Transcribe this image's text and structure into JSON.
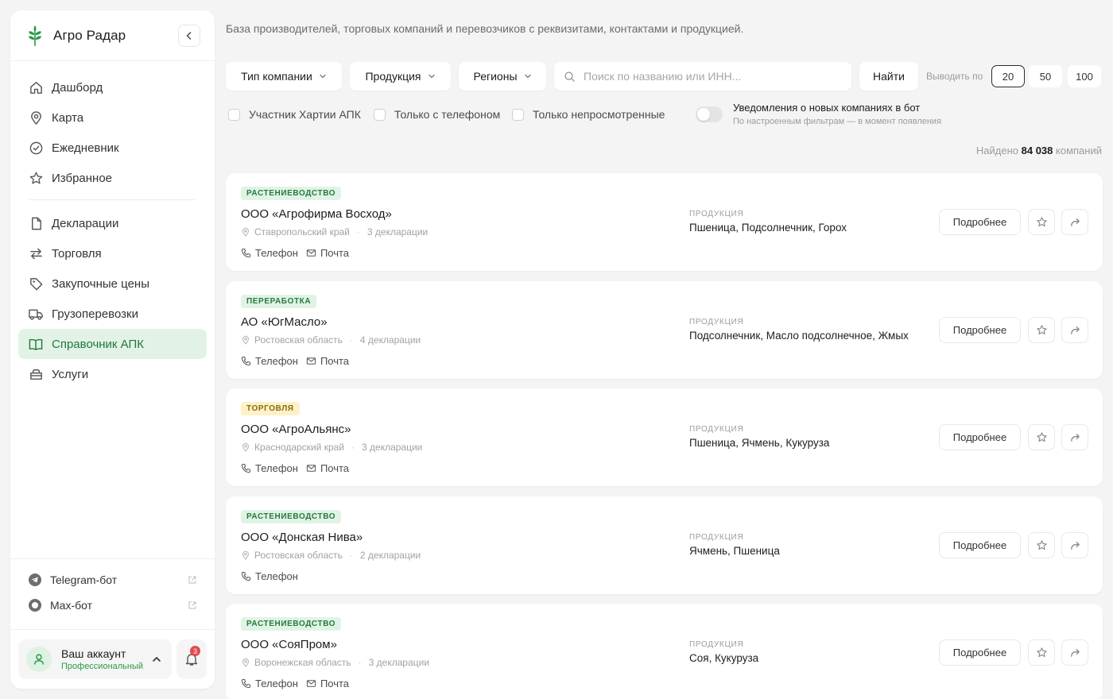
{
  "brand": {
    "name": "Агро Радар"
  },
  "nav": {
    "items": [
      {
        "label": "Дашборд",
        "icon": "home-icon"
      },
      {
        "label": "Карта",
        "icon": "map-pin-icon"
      },
      {
        "label": "Ежедневник",
        "icon": "check-circle-icon"
      },
      {
        "label": "Избранное",
        "icon": "star-icon"
      },
      {
        "label": "Декларации",
        "icon": "document-icon"
      },
      {
        "label": "Торговля",
        "icon": "swap-arrows-icon"
      },
      {
        "label": "Закупочные цены",
        "icon": "tag-icon"
      },
      {
        "label": "Грузоперевозки",
        "icon": "truck-icon"
      },
      {
        "label": "Справочник АПК",
        "icon": "book-open-icon",
        "active": true
      },
      {
        "label": "Услуги",
        "icon": "services-icon"
      }
    ]
  },
  "bots": [
    {
      "label": "Telegram-бот",
      "icon": "telegram-icon"
    },
    {
      "label": "Max-бот",
      "icon": "max-icon"
    }
  ],
  "account": {
    "name": "Ваш аккаунт",
    "plan": "Профессиональный",
    "notifications": "3"
  },
  "header": {
    "subtitle": "База производителей, торговых компаний и перевозчиков с реквизитами, контактами и продукцией."
  },
  "filters": {
    "company_type": "Тип компании",
    "products": "Продукция",
    "regions": "Регионы",
    "search_placeholder": "Поиск по названию или ИНН...",
    "find_label": "Найти",
    "per_page_label": "Выводить по",
    "per_page_options": [
      "20",
      "50",
      "100"
    ],
    "per_page_selected": "20"
  },
  "checks": {
    "charter": "Участник Хартии АПК",
    "with_phone": "Только с телефоном",
    "unviewed": "Только непросмотренные",
    "notif_title": "Уведомления о новых компаниях в бот",
    "notif_sub": "По настроенным фильтрам — в момент появления",
    "notif_enabled": false
  },
  "found": {
    "prefix": "Найдено",
    "count": "84 038",
    "suffix": "компаний"
  },
  "labels": {
    "products_label": "ПРОДУКЦИЯ",
    "phone": "Телефон",
    "email": "Почта",
    "details": "Подробнее"
  },
  "colors": {
    "accent": "#2a9a4a",
    "active_bg": "#e3f2e6",
    "tag_green_bg": "#e1f3e5",
    "tag_yellow_bg": "#fdf1c7"
  },
  "companies": [
    {
      "tag": "РАСТЕНИЕВОДСТВО",
      "tag_color": "green",
      "name": "ООО «Агрофирма Восход»",
      "region": "Ставропольский край",
      "declarations": "3 декларации",
      "products": "Пшеница, Подсолнечник, Горох",
      "has_phone": true,
      "has_email": true
    },
    {
      "tag": "ПЕРЕРАБОТКА",
      "tag_color": "green",
      "name": "АО «ЮгМасло»",
      "region": "Ростовская область",
      "declarations": "4 декларации",
      "products": "Подсолнечник, Масло подсолнечное, Жмых",
      "has_phone": true,
      "has_email": true
    },
    {
      "tag": "ТОРГОВЛЯ",
      "tag_color": "yellow",
      "name": "ООО «АгроАльянс»",
      "region": "Краснодарский край",
      "declarations": "3 декларации",
      "products": "Пшеница, Ячмень, Кукуруза",
      "has_phone": true,
      "has_email": true
    },
    {
      "tag": "РАСТЕНИЕВОДСТВО",
      "tag_color": "green",
      "name": "ООО «Донская Нива»",
      "region": "Ростовская область",
      "declarations": "2 декларации",
      "products": "Ячмень, Пшеница",
      "has_phone": true,
      "has_email": false
    },
    {
      "tag": "РАСТЕНИЕВОДСТВО",
      "tag_color": "green",
      "name": "ООО «СояПром»",
      "region": "Воронежская область",
      "declarations": "3 декларации",
      "products": "Соя, Кукуруза",
      "has_phone": true,
      "has_email": true
    }
  ]
}
